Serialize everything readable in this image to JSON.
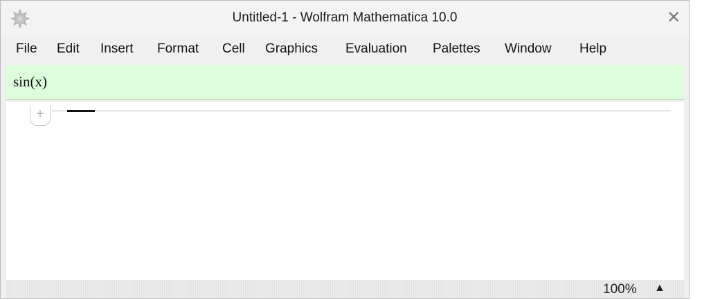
{
  "window": {
    "title": "Untitled-1 - Wolfram Mathematica 10.0"
  },
  "icons": {
    "app": "mathematica-spikey-icon",
    "close": "close-icon",
    "zoom_menu": "triangle-up-icon"
  },
  "close_glyph": "✕",
  "menu": [
    "File",
    "Edit",
    "Insert",
    "Format",
    "Cell",
    "Graphics",
    "Evaluation",
    "Palettes",
    "Window",
    "Help"
  ],
  "input_bar": {
    "expression": "sin(x)"
  },
  "cell": {
    "plus_glyph": "+"
  },
  "status": {
    "zoom": "100%",
    "zoom_arrow": "▲"
  },
  "colors": {
    "input_bar_bg": "#dcfcdc",
    "window_bg": "#f0f0f0",
    "notebook_bg": "#ffffff"
  }
}
